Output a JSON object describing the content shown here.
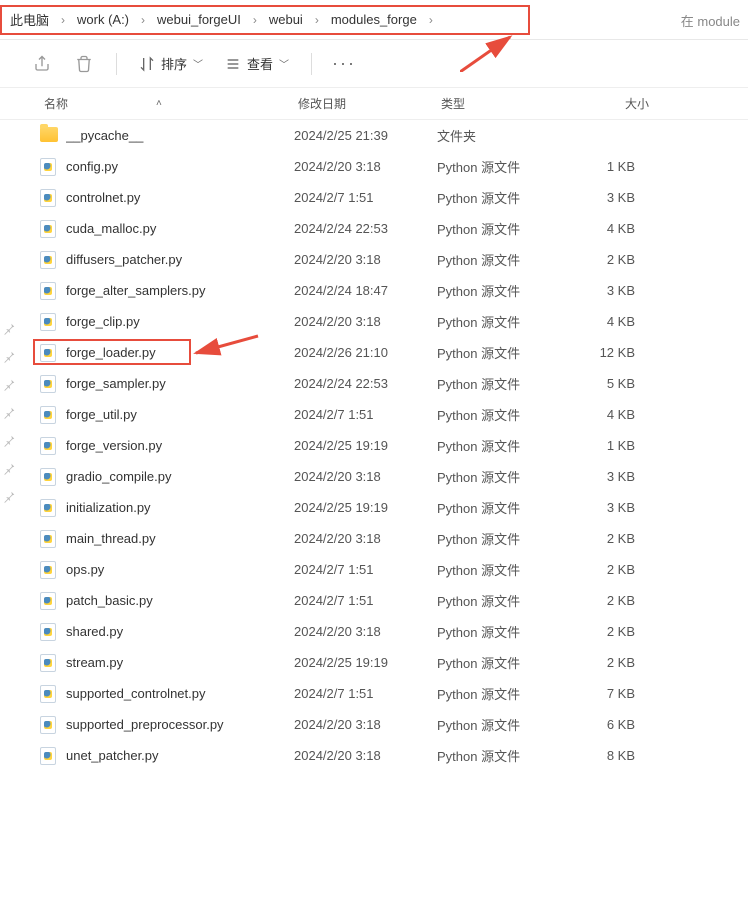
{
  "breadcrumb": {
    "items": [
      "此电脑",
      "work (A:)",
      "webui_forgeUI",
      "webui",
      "modules_forge"
    ]
  },
  "search_hint_prefix": "在 module",
  "toolbar": {
    "sort_label": "排序",
    "view_label": "查看"
  },
  "headers": {
    "name": "名称",
    "date": "修改日期",
    "type": "类型",
    "size": "大小"
  },
  "files": [
    {
      "icon": "folder",
      "name": "__pycache__",
      "date": "2024/2/25 21:39",
      "type": "文件夹",
      "size": ""
    },
    {
      "icon": "py",
      "name": "config.py",
      "date": "2024/2/20 3:18",
      "type": "Python 源文件",
      "size": "1 KB"
    },
    {
      "icon": "py",
      "name": "controlnet.py",
      "date": "2024/2/7 1:51",
      "type": "Python 源文件",
      "size": "3 KB"
    },
    {
      "icon": "py",
      "name": "cuda_malloc.py",
      "date": "2024/2/24 22:53",
      "type": "Python 源文件",
      "size": "4 KB"
    },
    {
      "icon": "py",
      "name": "diffusers_patcher.py",
      "date": "2024/2/20 3:18",
      "type": "Python 源文件",
      "size": "2 KB"
    },
    {
      "icon": "py",
      "name": "forge_alter_samplers.py",
      "date": "2024/2/24 18:47",
      "type": "Python 源文件",
      "size": "3 KB"
    },
    {
      "icon": "py",
      "name": "forge_clip.py",
      "date": "2024/2/20 3:18",
      "type": "Python 源文件",
      "size": "4 KB"
    },
    {
      "icon": "py",
      "name": "forge_loader.py",
      "date": "2024/2/26 21:10",
      "type": "Python 源文件",
      "size": "12 KB",
      "highlight": true
    },
    {
      "icon": "py",
      "name": "forge_sampler.py",
      "date": "2024/2/24 22:53",
      "type": "Python 源文件",
      "size": "5 KB"
    },
    {
      "icon": "py",
      "name": "forge_util.py",
      "date": "2024/2/7 1:51",
      "type": "Python 源文件",
      "size": "4 KB"
    },
    {
      "icon": "py",
      "name": "forge_version.py",
      "date": "2024/2/25 19:19",
      "type": "Python 源文件",
      "size": "1 KB"
    },
    {
      "icon": "py",
      "name": "gradio_compile.py",
      "date": "2024/2/20 3:18",
      "type": "Python 源文件",
      "size": "3 KB"
    },
    {
      "icon": "py",
      "name": "initialization.py",
      "date": "2024/2/25 19:19",
      "type": "Python 源文件",
      "size": "3 KB"
    },
    {
      "icon": "py",
      "name": "main_thread.py",
      "date": "2024/2/20 3:18",
      "type": "Python 源文件",
      "size": "2 KB"
    },
    {
      "icon": "py",
      "name": "ops.py",
      "date": "2024/2/7 1:51",
      "type": "Python 源文件",
      "size": "2 KB"
    },
    {
      "icon": "py",
      "name": "patch_basic.py",
      "date": "2024/2/7 1:51",
      "type": "Python 源文件",
      "size": "2 KB"
    },
    {
      "icon": "py",
      "name": "shared.py",
      "date": "2024/2/20 3:18",
      "type": "Python 源文件",
      "size": "2 KB"
    },
    {
      "icon": "py",
      "name": "stream.py",
      "date": "2024/2/25 19:19",
      "type": "Python 源文件",
      "size": "2 KB"
    },
    {
      "icon": "py",
      "name": "supported_controlnet.py",
      "date": "2024/2/7 1:51",
      "type": "Python 源文件",
      "size": "7 KB"
    },
    {
      "icon": "py",
      "name": "supported_preprocessor.py",
      "date": "2024/2/20 3:18",
      "type": "Python 源文件",
      "size": "6 KB"
    },
    {
      "icon": "py",
      "name": "unet_patcher.py",
      "date": "2024/2/20 3:18",
      "type": "Python 源文件",
      "size": "8 KB"
    }
  ]
}
